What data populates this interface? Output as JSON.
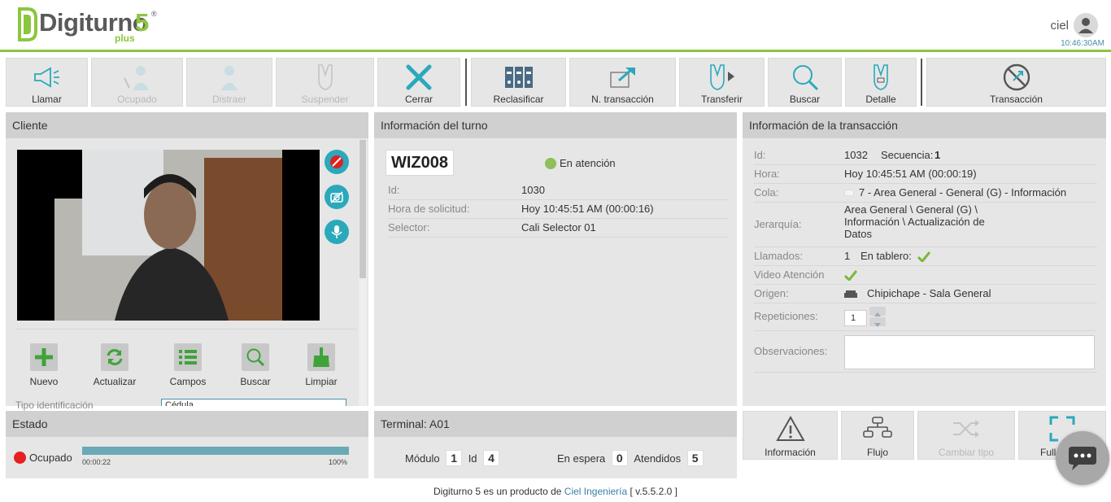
{
  "header": {
    "logo_word": "Digiturno",
    "logo_number": "5",
    "logo_reg": "®",
    "logo_plus": "plus",
    "user": "ciel",
    "time": "10:46:30AM"
  },
  "toolbar": [
    {
      "label": "Llamar",
      "icon": "megaphone-icon",
      "enabled": true
    },
    {
      "label": "Ocupado",
      "icon": "busy-person-icon",
      "enabled": false
    },
    {
      "label": "Distraer",
      "icon": "person-icon",
      "enabled": false
    },
    {
      "label": "Suspender",
      "icon": "ticket-icon",
      "enabled": false
    },
    {
      "label": "Cerrar",
      "icon": "close-icon",
      "enabled": true
    },
    {
      "label": "Reclasificar",
      "icon": "binders-icon",
      "enabled": true
    },
    {
      "label": "N. transacción",
      "icon": "new-transaction-icon",
      "enabled": true
    },
    {
      "label": "Transferir",
      "icon": "transfer-icon",
      "enabled": true
    },
    {
      "label": "Buscar",
      "icon": "search-icon",
      "enabled": true
    },
    {
      "label": "Detalle",
      "icon": "detail-icon",
      "enabled": true
    },
    {
      "label": "Transacción",
      "icon": "no-transaction-icon",
      "enabled": true
    }
  ],
  "cliente": {
    "title": "Cliente",
    "buttons": [
      {
        "label": "Nuevo",
        "icon": "plus-icon"
      },
      {
        "label": "Actualizar",
        "icon": "refresh-icon"
      },
      {
        "label": "Campos",
        "icon": "list-icon"
      },
      {
        "label": "Buscar",
        "icon": "search-icon"
      },
      {
        "label": "Limpiar",
        "icon": "broom-icon"
      }
    ],
    "partial_label": "Tipo identificación",
    "partial_value": "Cédula"
  },
  "turno": {
    "title": "Información del turno",
    "code": "WIZ008",
    "status": "En atención",
    "status_color": "#8dbf5a",
    "rows": [
      {
        "k": "Id:",
        "v": "1030"
      },
      {
        "k": "Hora de solicitud:",
        "v": "Hoy 10:45:51 AM (00:00:16)"
      },
      {
        "k": "Selector:",
        "v": "Cali Selector 01"
      }
    ]
  },
  "transaccion": {
    "title": "Información de la transacción",
    "id_label": "Id:",
    "id": "1032",
    "secuencia_label": "Secuencia:",
    "secuencia": "1",
    "hora_label": "Hora:",
    "hora": "Hoy 10:45:51 AM (00:00:19)",
    "cola_label": "Cola:",
    "cola": "7 - Area General - General (G) - Información",
    "jerarquia_label": "Jerarquía:",
    "jerarquia_1": "Area General \\ General (G) \\",
    "jerarquia_2": "Información \\ Actualización de",
    "jerarquia_3": "Datos",
    "llamados_label": "Llamados:",
    "llamados": "1",
    "tablero_label": "En tablero:",
    "video_label": "Video Atención",
    "origen_label": "Origen:",
    "origen": "Chipichape - Sala General",
    "repeticiones_label": "Repeticiones:",
    "repeticiones": "1",
    "observaciones_label": "Observaciones:",
    "observaciones": ""
  },
  "estado": {
    "title": "Estado",
    "status": "Ocupado",
    "status_color": "#e52020",
    "elapsed": "00:00:22",
    "progress_label": "100%",
    "progress": 1.0
  },
  "terminal": {
    "title": "Terminal: A01",
    "modulo_label": "Módulo",
    "modulo": "1",
    "id_label": "Id",
    "id": "4",
    "espera_label": "En espera",
    "espera": "0",
    "atendidos_label": "Atendidos",
    "atendidos": "5"
  },
  "bottom_buttons": [
    {
      "label": "Información",
      "icon": "warning-icon",
      "enabled": true
    },
    {
      "label": "Flujo",
      "icon": "flow-icon",
      "enabled": true
    },
    {
      "label": "Cambiar tipo",
      "icon": "shuffle-icon",
      "enabled": false
    },
    {
      "label": "Full",
      "icon": "fullscreen-icon",
      "enabled": true
    }
  ],
  "footer": {
    "prefix": "Digiturno 5 es un producto de",
    "link": "Ciel Ingeniería",
    "version": "[ v.5.5.2.0 ]"
  },
  "colors": {
    "accent_green": "#8cc63f",
    "teal": "#2aa9bb",
    "progress": "#6aa9b5"
  }
}
